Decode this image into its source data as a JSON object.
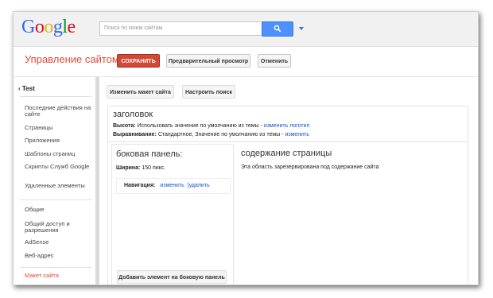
{
  "header": {
    "logo_letters": [
      {
        "ch": "G",
        "color": "#3369e8"
      },
      {
        "ch": "o",
        "color": "#d50f25"
      },
      {
        "ch": "o",
        "color": "#eeb211"
      },
      {
        "ch": "g",
        "color": "#3369e8"
      },
      {
        "ch": "l",
        "color": "#009925"
      },
      {
        "ch": "e",
        "color": "#d50f25"
      }
    ],
    "search_placeholder": "Поиск по моим сайтам",
    "search_button_icon": "search-icon"
  },
  "toolbar": {
    "title": "Управление сайтом",
    "save_label": "СОХРАНИТЬ",
    "preview_label": "Предварительный просмотр",
    "cancel_label": "Отменить"
  },
  "sidebar": {
    "back_label": "Test",
    "items": [
      {
        "label": "Последние действия на сайте"
      },
      {
        "label": "Страницы"
      },
      {
        "label": "Приложения"
      },
      {
        "label": "Шаблоны страниц"
      },
      {
        "label": "Скрипты Служб Google"
      },
      {
        "label": "Удаленные элементы"
      },
      {
        "label": "Общие"
      },
      {
        "label": "Общий доступ и разрешения"
      },
      {
        "label": "AdSense"
      },
      {
        "label": "Веб-адрес"
      },
      {
        "label": "Макет сайта"
      }
    ]
  },
  "content": {
    "change_layout_label": "Изменить макет сайта",
    "configure_search_label": "Настроить поиск",
    "header_region": {
      "title": "заголовок",
      "height_label": "Высота:",
      "height_value": "Использовать значение по умолчанию из темы -",
      "height_link": "изменить логотип",
      "align_label": "Выравнивание:",
      "align_value": "Стандартное, Значение по умолчанию из темы -",
      "align_link": "изменить"
    },
    "side_panel": {
      "title": "боковая панель:",
      "width_label": "Ширина:",
      "width_value": "150 пикс.",
      "nav_label": "Навигация:",
      "nav_edit_link": "изменить",
      "nav_separator": "|",
      "nav_delete_link": "удалить",
      "add_button_label": "Добавить элемент на боковую панель"
    },
    "main_panel": {
      "title": "содержание страницы",
      "text": "Эта область зарезервирована под содержание сайта"
    }
  }
}
